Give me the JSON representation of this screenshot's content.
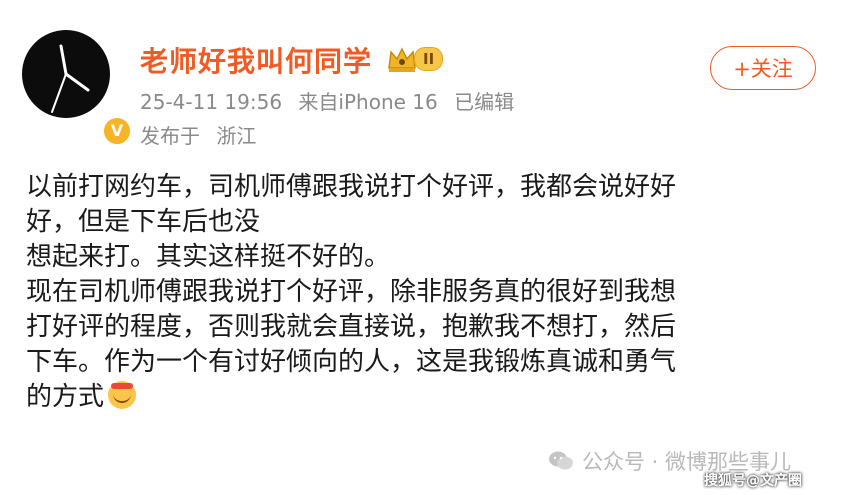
{
  "post": {
    "user": {
      "name": "老师好我叫何同学",
      "vip_level": "II",
      "verified_mark": "V"
    },
    "meta": {
      "datetime": "25-4-11 19:56",
      "source": "来自iPhone 16",
      "edited": "已编辑",
      "location_label": "发布于",
      "location": "浙江"
    },
    "follow_label": "+关注",
    "body_lines": [
      "以前打网约车，司机师傅跟我说打个好评，我都会说好好",
      "好，但是下车后也没",
      "想起来打。其实这样挺不好的。",
      "现在司机师傅跟我说打个好评，除非服务真的很好到我想",
      "打好评的程度，否则我就会直接说，抱歉我不想打，然后",
      "下车。作为一个有讨好倾向的人，这是我锻炼真诚和勇气",
      "的方式"
    ]
  },
  "watermarks": {
    "wechat": "公众号 · 微博那些事儿",
    "sohu": "搜狐号@文产圈"
  },
  "colors": {
    "accent": "#f15a22",
    "meta_text": "#8a8a8a",
    "vip_gold": "#f7c548",
    "verified": "#f6b526"
  },
  "icons": [
    "avatar-image",
    "verified-badge-icon",
    "vip-crown-icon",
    "blush-emoji-icon",
    "wechat-icon"
  ]
}
